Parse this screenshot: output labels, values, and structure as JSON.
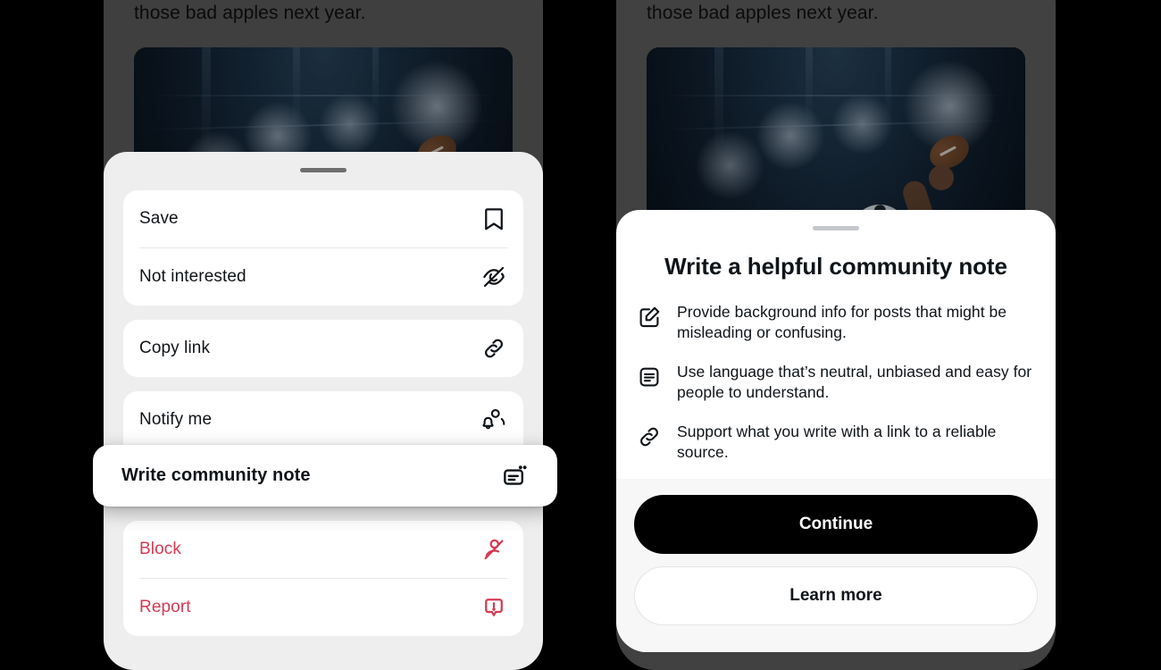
{
  "post": {
    "text": "those bad apples next year.",
    "media_alt": "football-player-stadium-photo"
  },
  "left_sheet": {
    "grabber": "drag-handle",
    "groups": [
      {
        "items": [
          {
            "label": "Save",
            "icon": "bookmark-icon",
            "style": "default"
          },
          {
            "label": "Not interested",
            "icon": "eye-off-icon",
            "style": "default"
          }
        ]
      },
      {
        "items": [
          {
            "label": "Copy link",
            "icon": "link-icon",
            "style": "default"
          }
        ]
      },
      {
        "items": [
          {
            "label": "Notify me",
            "icon": "person-bell-icon",
            "style": "default"
          },
          {
            "label": "Write community note",
            "icon": "community-note-icon",
            "style": "default"
          }
        ]
      },
      {
        "items": [
          {
            "label": "Block",
            "icon": "person-block-icon",
            "style": "danger"
          },
          {
            "label": "Report",
            "icon": "report-flag-icon",
            "style": "danger"
          }
        ]
      }
    ],
    "highlighted_item": {
      "label": "Write community note",
      "icon": "community-note-icon"
    }
  },
  "right_sheet": {
    "grabber": "drag-handle",
    "title": "Write a helpful community note",
    "bullets": [
      {
        "icon": "pencil-square-icon",
        "text": "Provide background info for posts that might be misleading or confusing."
      },
      {
        "icon": "document-lines-icon",
        "text": "Use language that’s neutral, unbiased and easy for people to understand."
      },
      {
        "icon": "link-icon",
        "text": "Support what you write with a link to a reliable source."
      }
    ],
    "primary_button": "Continue",
    "secondary_button": "Learn more"
  },
  "colors": {
    "background": "#000000",
    "sheet_gray": "#eeeeee",
    "card_white": "#ffffff",
    "text_primary": "#0f1419",
    "danger": "#d63a52",
    "button_primary_bg": "#000000",
    "button_primary_text": "#ffffff",
    "grabber_dark": "#6e6e6e",
    "grabber_light": "#c4c7cc"
  }
}
